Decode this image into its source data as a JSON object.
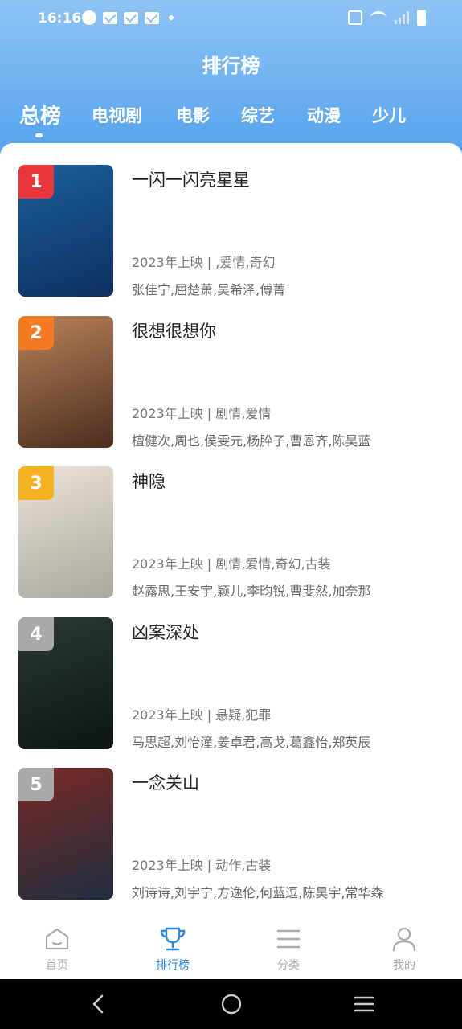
{
  "status_bar": {
    "time": "16:16"
  },
  "header": {
    "title": "排行榜",
    "tabs": [
      {
        "label": "总榜",
        "active": true
      },
      {
        "label": "电视剧",
        "active": false
      },
      {
        "label": "电影",
        "active": false
      },
      {
        "label": "综艺",
        "active": false
      },
      {
        "label": "动漫",
        "active": false
      },
      {
        "label": "少儿",
        "active": false
      }
    ]
  },
  "ranking": [
    {
      "rank": "1",
      "title": "一闪一闪亮星星",
      "meta": "2023年上映 | ,爱情,奇幻",
      "cast": " 张佳宁,屈楚萧,吴希泽,傅菁",
      "badge_color": "#e8363a",
      "poster_colors": [
        "#1b5f9e",
        "#0d2f5e"
      ]
    },
    {
      "rank": "2",
      "title": "很想很想你",
      "meta": "2023年上映 | 剧情,爱情",
      "cast": "檀健次,周也,侯雯元,杨肸子,曹恩齐,陈昊蓝",
      "badge_color": "#f57b22",
      "poster_colors": [
        "#b9825a",
        "#4b2d1f"
      ]
    },
    {
      "rank": "3",
      "title": "神隐",
      "meta": "2023年上映 | 剧情,爱情,奇幻,古装",
      "cast": "赵露思,王安宇,颖儿,李昀锐,曹斐然,加奈那",
      "badge_color": "#f5b323",
      "poster_colors": [
        "#ece4d6",
        "#a9a7a0"
      ]
    },
    {
      "rank": "4",
      "title": "凶案深处",
      "meta": "2023年上映 | 悬疑,犯罪",
      "cast": "马思超,刘怡潼,姜卓君,高戈,葛鑫怡,郑英辰",
      "badge_color": "#a9a9a9",
      "poster_colors": [
        "#2a3a36",
        "#0e1514"
      ]
    },
    {
      "rank": "5",
      "title": "一念关山",
      "meta": "2023年上映 | 动作,古装",
      "cast": "刘诗诗,刘宇宁,方逸伦,何蓝逗,陈昊宇,常华森",
      "badge_color": "#a9a9a9",
      "poster_colors": [
        "#7a2a24",
        "#1f2c3f"
      ]
    }
  ],
  "bottom_nav": [
    {
      "label": "首页",
      "icon": "home-icon",
      "active": false
    },
    {
      "label": "排行榜",
      "icon": "trophy-icon",
      "active": true
    },
    {
      "label": "分类",
      "icon": "menu-icon",
      "active": false
    },
    {
      "label": "我的",
      "icon": "user-icon",
      "active": false
    }
  ],
  "colors": {
    "header_top": "#8fc3f4",
    "header_bottom": "#4a9cec",
    "accent": "#2f86e0"
  }
}
